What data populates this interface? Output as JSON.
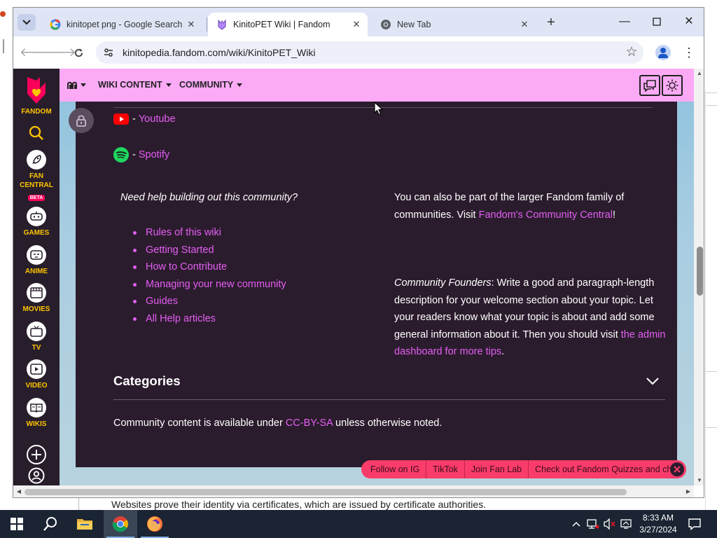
{
  "browser": {
    "tabs": [
      {
        "title": "kinitopet png - Google Search",
        "icon": "google-icon",
        "active": false
      },
      {
        "title": "KinitoPET Wiki | Fandom",
        "icon": "fandom-wiki-icon",
        "active": true
      },
      {
        "title": "New Tab",
        "icon": "chrome-icon",
        "active": false
      }
    ],
    "url": "kinitopedia.fandom.com/wiki/KinitoPET_Wiki"
  },
  "fandom": {
    "brand": "FANDOM",
    "rail": [
      {
        "id": "fan-central",
        "label": "FAN\nCENTRAL",
        "badge": "BETA"
      },
      {
        "id": "games",
        "label": "GAMES"
      },
      {
        "id": "anime",
        "label": "ANIME"
      },
      {
        "id": "movies",
        "label": "MOVIES"
      },
      {
        "id": "tv",
        "label": "TV"
      },
      {
        "id": "video",
        "label": "VIDEO"
      },
      {
        "id": "wikis",
        "label": "WIKIS"
      }
    ],
    "nav": {
      "wiki_content": "WIKI CONTENT",
      "community": "COMMUNITY"
    },
    "colors": {
      "accent_link": "#e45ef4",
      "nav_bg": "#fcaaf6",
      "content_bg": "#2b1c2d",
      "rail_label": "#ffc500",
      "ticker_bg": "#fa3c6a"
    }
  },
  "article": {
    "social": [
      {
        "icon": "youtube-icon",
        "label": "Youtube"
      },
      {
        "icon": "spotify-icon",
        "label": "Spotify"
      }
    ],
    "social_dash": "-",
    "help_question": "Need help building out this community?",
    "help_links": [
      "Rules of this wiki",
      "Getting Started",
      "How to Contribute",
      "Managing your new community",
      "Guides",
      "All Help articles"
    ],
    "family": {
      "text_before": "You can also be part of the larger Fandom family of communities. Visit ",
      "link": "Fandom's Community Central",
      "text_after": "!"
    },
    "founders": {
      "label": "Community Founders",
      "text": ": Write a good and paragraph-length description for your welcome section about your topic. Let your readers know what your topic is about and add some general information about it. Then you should visit ",
      "link": "the admin dashboard for more tips",
      "text_after": "."
    },
    "categories_title": "Categories",
    "license": {
      "before": "Community content is available under ",
      "link": "CC-BY-SA",
      "after": " unless otherwise noted."
    }
  },
  "ticker": [
    "Follow on IG",
    "TikTok",
    "Join Fan Lab",
    "Check out Fandom Quizzes and cha"
  ],
  "background_page": {
    "text": "Websites prove their identity via certificates, which are issued by certificate authorities."
  },
  "taskbar": {
    "time": "8:33 AM",
    "date": "3/27/2024"
  }
}
